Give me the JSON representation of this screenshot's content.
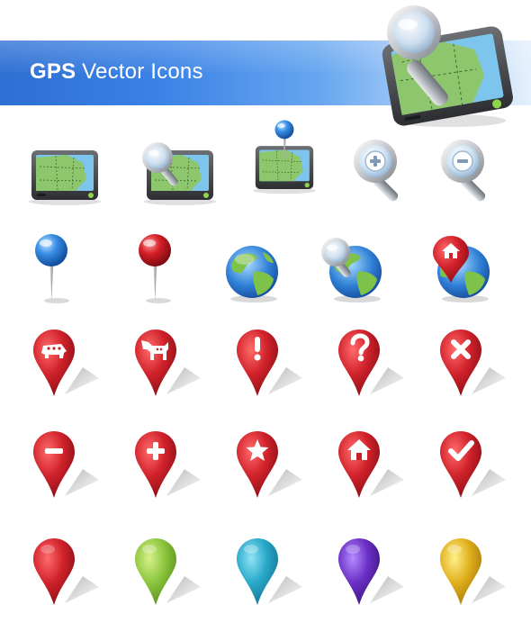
{
  "banner": {
    "title_bold": "GPS",
    "title_rest": "Vector Icons"
  },
  "colors": {
    "banner_blue": "#2d6fd3",
    "pin_red": "#c8202a",
    "pin_green": "#8cc63f",
    "pin_cyan": "#29a9c9",
    "pin_purple": "#6a2fc4",
    "pin_yellow": "#e0b01c",
    "map_green": "#8dc66c",
    "map_water": "#7ec5ee"
  },
  "icons": [
    [
      "gps-device-icon",
      "gps-device-search-icon",
      "gps-device-pin-icon",
      "zoom-in-icon",
      "zoom-out-icon"
    ],
    [
      "blue-pushpin-icon",
      "red-pushpin-icon",
      "globe-icon",
      "globe-search-icon",
      "globe-home-pin-icon"
    ],
    [
      "republican-pin-icon",
      "democrat-pin-icon",
      "exclamation-pin-icon",
      "question-pin-icon",
      "close-pin-icon"
    ],
    [
      "minus-pin-icon",
      "plus-pin-icon",
      "star-pin-icon",
      "home-pin-icon",
      "check-pin-icon"
    ],
    [
      "red-pin-icon",
      "green-pin-icon",
      "cyan-pin-icon",
      "purple-pin-icon",
      "yellow-pin-icon"
    ]
  ]
}
